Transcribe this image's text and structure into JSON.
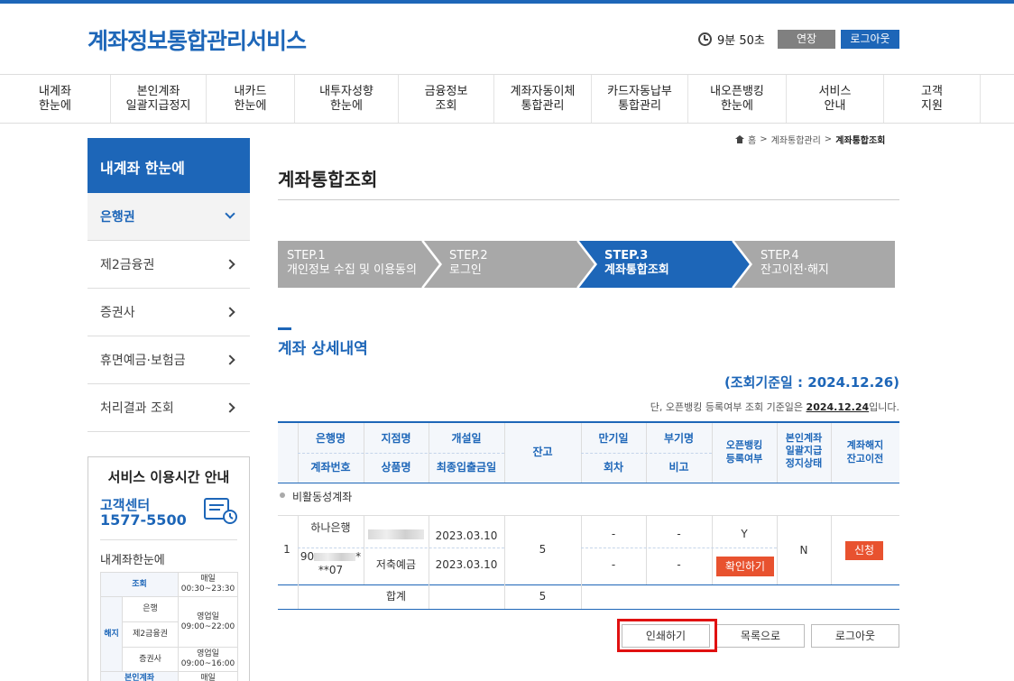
{
  "header": {
    "brand": "계좌정보통합관리서비스",
    "timer": "9분 50초",
    "extend_label": "연장",
    "logout_label": "로그아웃"
  },
  "gnb": [
    "내계좌\n한눈에",
    "본인계좌\n일괄지급정지",
    "내카드\n한눈에",
    "내투자성향\n한눈에",
    "금융정보\n조회",
    "계좌자동이체\n통합관리",
    "카드자동납부\n통합관리",
    "내오픈뱅킹\n한눈에",
    "서비스\n안내",
    "고객\n지원"
  ],
  "lnb": {
    "title": "내계좌 한눈에",
    "items": [
      "은행권",
      "제2금융권",
      "증권사",
      "휴면예금·보험금",
      "처리결과 조회"
    ]
  },
  "service_box": {
    "title": "서비스 이용시간 안내",
    "cc_label": "고객센터",
    "cc_number": "1577-5500",
    "subtitle": "내계좌한눈에",
    "rows": {
      "r1_label": "조회",
      "r1_time": "매일\n00:30~23:30",
      "cancel_label": "해지",
      "r2_label": "은행",
      "r2_time": "영업일\n09:00~22:00",
      "r3_label": "제2금융권",
      "r4_label": "증권사",
      "r4_time": "영업일\n09:00~16:00",
      "r5_label": "본인계좌",
      "r5_time": "매일"
    }
  },
  "breadcrumb": {
    "home": "홈",
    "sep": ">",
    "level1": "계좌통합관리",
    "level2": "계좌통합조회"
  },
  "page_title": "계좌통합조회",
  "steps": [
    {
      "label": "STEP.1\n개인정보 수집 및 이용동의"
    },
    {
      "label": "STEP.2\n로그인"
    },
    {
      "label": "STEP.3\n계좌통합조회"
    },
    {
      "label": "STEP.4\n잔고이전·해지"
    }
  ],
  "section_title": "계좌 상세내역",
  "basis": {
    "text": "(조회기준일 : 2024.12.26)",
    "note_prefix": "단, 오픈뱅킹 등록여부 조회 기준일은 ",
    "note_date": "2024.12.24",
    "note_suffix": "입니다."
  },
  "table": {
    "headers": {
      "bank": "은행명",
      "branch": "지점명",
      "opened": "개설일",
      "acct_no": "계좌번호",
      "product": "상품명",
      "last_txn": "최종입출금일",
      "balance": "잔고",
      "maturity": "만기일",
      "round": "회차",
      "cosign": "부기명",
      "remark": "비고",
      "openbank": "오픈뱅킹\n등록여부",
      "suspend": "본인계좌\n일괄지급\n정지상태",
      "close": "계좌해지\n잔고이전"
    },
    "group_label": "비활동성계좌",
    "row": {
      "no": "1",
      "bank": "하나은행",
      "opened": "2023.03.10",
      "acct_prefix": "90",
      "acct_mid": "*",
      "acct_suffix": "**07",
      "product": "저축예금",
      "last_txn": "2023.03.10",
      "balance": "5",
      "maturity": "-",
      "round": "-",
      "cosign": "-",
      "remark": "-",
      "openbank": "Y",
      "confirm_label": "확인하기",
      "suspend": "N",
      "apply_label": "신청"
    },
    "total_label": "합계",
    "total_value": "5"
  },
  "actions": {
    "print": "인쇄하기",
    "list": "목록으로",
    "logout": "로그아웃"
  },
  "colors": {
    "primary": "#1d66b8",
    "accent_red": "#e8522f",
    "step_gray": "#a8a8a8",
    "highlight": "#e01111"
  }
}
